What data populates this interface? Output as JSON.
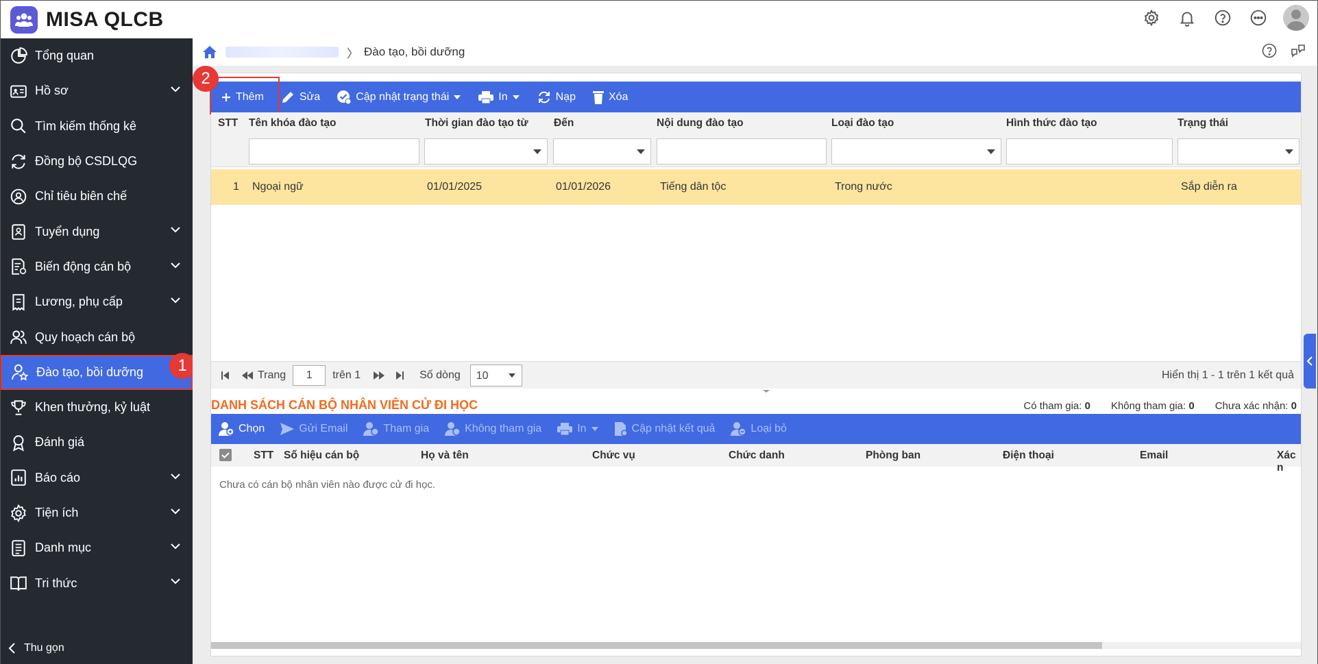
{
  "app": {
    "brand": "MISA QLCB"
  },
  "sidebar": {
    "items": [
      {
        "label": "Tổng quan",
        "icon": "pie-chart-icon",
        "expandable": false
      },
      {
        "label": "Hồ sơ",
        "icon": "id-card-icon",
        "expandable": true
      },
      {
        "label": "Tìm kiếm thống kê",
        "icon": "search-icon",
        "expandable": false
      },
      {
        "label": "Đồng bộ CSDLQG",
        "icon": "sync-icon",
        "expandable": false
      },
      {
        "label": "Chỉ tiêu biên chế",
        "icon": "user-circle-icon",
        "expandable": false
      },
      {
        "label": "Tuyển dụng",
        "icon": "clipboard-user-icon",
        "expandable": true
      },
      {
        "label": "Biến động cán bộ",
        "icon": "document-gear-icon",
        "expandable": true
      },
      {
        "label": "Lương, phụ cấp",
        "icon": "receipt-icon",
        "expandable": true
      },
      {
        "label": "Quy hoạch cán bộ",
        "icon": "users-icon",
        "expandable": false
      },
      {
        "label": "Đào tạo, bồi dưỡng",
        "icon": "user-star-icon",
        "expandable": false,
        "active": true
      },
      {
        "label": "Khen thưởng, kỷ luật",
        "icon": "trophy-icon",
        "expandable": false
      },
      {
        "label": "Đánh giá",
        "icon": "award-icon",
        "expandable": false
      },
      {
        "label": "Báo cáo",
        "icon": "report-icon",
        "expandable": true
      },
      {
        "label": "Tiện ích",
        "icon": "gear-icon",
        "expandable": true
      },
      {
        "label": "Danh mục",
        "icon": "list-doc-icon",
        "expandable": true
      },
      {
        "label": "Tri thức",
        "icon": "book-icon",
        "expandable": true
      }
    ],
    "collapse_label": "Thu gọn"
  },
  "breadcrumb": {
    "current": "Đào tạo, bồi dưỡng"
  },
  "toolbar": {
    "add": "Thêm",
    "edit": "Sửa",
    "update_status": "Cập nhật trạng thái",
    "print": "In",
    "reload": "Nạp",
    "delete": "Xóa"
  },
  "grid": {
    "columns": [
      "STT",
      "Tên khóa đào tạo",
      "Thời gian đào tạo từ",
      "Đến",
      "Nội dung đào tạo",
      "Loại đào tạo",
      "Hình thức đào tạo",
      "Trạng thái"
    ],
    "rows": [
      {
        "stt": "1",
        "name": "Ngoại ngữ",
        "from": "01/01/2025",
        "to": "01/01/2026",
        "content": "Tiếng dân tộc",
        "type": "Trong nước",
        "form": "",
        "status": "Sắp diễn ra"
      }
    ]
  },
  "pager": {
    "page_label": "Trang",
    "page": "1",
    "of_label": "trên 1",
    "rows_label": "Số dòng",
    "rows": "10",
    "summary": "Hiển thị 1 - 1 trên 1 kết quả"
  },
  "section2": {
    "title": "DANH SÁCH CÁN BỘ NHÂN VIÊN CỬ ĐI HỌC",
    "stats": {
      "joined_label": "Có tham gia:",
      "joined": "0",
      "not_joined_label": "Không tham gia:",
      "not_joined": "0",
      "unconfirmed_label": "Chưa xác nhận:",
      "unconfirmed": "0"
    },
    "toolbar": {
      "choose": "Chọn",
      "send_email": "Gửi Email",
      "join": "Tham gia",
      "not_join": "Không tham gia",
      "print": "In",
      "update_result": "Cập nhật kết quả",
      "remove": "Loại bỏ"
    },
    "columns": [
      "STT",
      "Số hiệu cán bộ",
      "Họ và tên",
      "Chức vụ",
      "Chức danh",
      "Phòng ban",
      "Điện thoại",
      "Email",
      "Xác n"
    ],
    "empty": "Chưa có cán bộ nhân viên nào được cử đi học."
  },
  "annotations": {
    "step1": "1",
    "step2": "2"
  },
  "colors": {
    "sidebar_bg": "#252a31",
    "accent": "#4169e1",
    "highlight_row": "#fde59f",
    "section_title": "#f26b1d",
    "callout": "#e53935"
  }
}
